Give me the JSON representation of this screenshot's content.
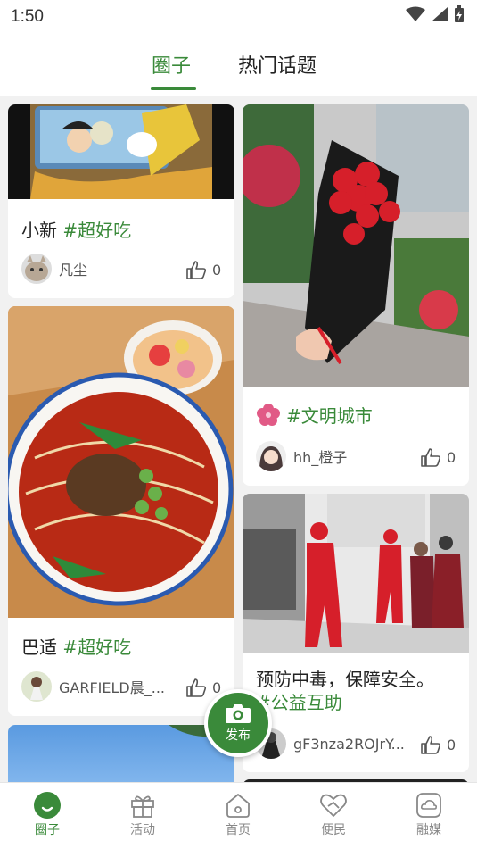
{
  "status_bar": {
    "time": "1:50"
  },
  "tabs": [
    {
      "label": "圈子",
      "active": true
    },
    {
      "label": "热门话题",
      "active": false
    }
  ],
  "feed": {
    "card1": {
      "title": "小新",
      "tag": "#超好吃",
      "author": "凡尘",
      "likes": "0"
    },
    "card2": {
      "title": "巴适",
      "tag": "#超好吃",
      "author": "GARFIELD晨_...",
      "likes": "0"
    },
    "card3": {
      "tag": "#文明城市",
      "author": "hh_橙子",
      "likes": "0"
    },
    "card4": {
      "title": "预防中毒，保障安全。",
      "tag": "#公益互助",
      "author": "gF3nza2ROJrY...",
      "likes": "0"
    }
  },
  "publish": {
    "label": "发布"
  },
  "nav": [
    {
      "label": "圈子",
      "icon": "circle-smile-icon",
      "active": true
    },
    {
      "label": "活动",
      "icon": "gift-icon",
      "active": false
    },
    {
      "label": "首页",
      "icon": "home-icon",
      "active": false
    },
    {
      "label": "便民",
      "icon": "heart-hands-icon",
      "active": false
    },
    {
      "label": "融媒",
      "icon": "cloud-box-icon",
      "active": false
    }
  ],
  "colors": {
    "accent": "#3a8a3a",
    "background": "#f1f1f1"
  }
}
